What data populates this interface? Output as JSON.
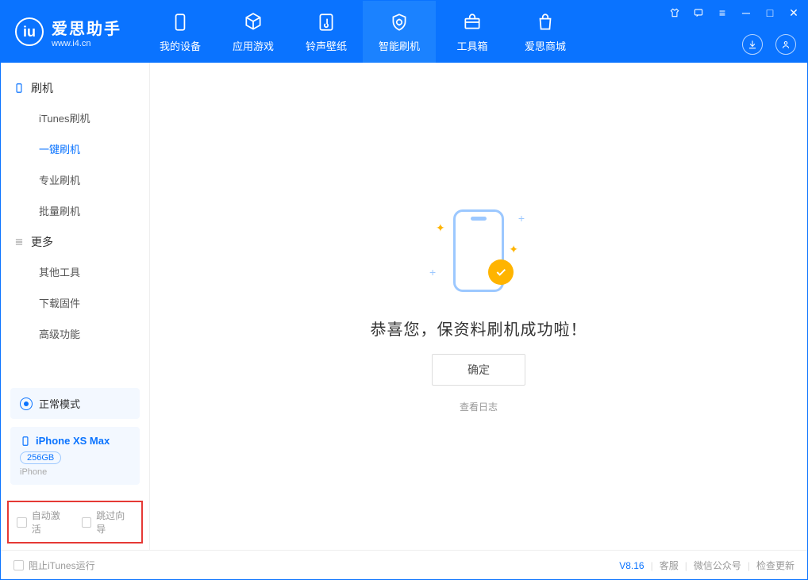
{
  "app": {
    "name": "爱思助手",
    "url": "www.i4.cn"
  },
  "nav": {
    "device": "我的设备",
    "apps": "应用游戏",
    "ringtone": "铃声壁纸",
    "flash": "智能刷机",
    "toolbox": "工具箱",
    "store": "爱思商城"
  },
  "sidebar": {
    "section_flash": "刷机",
    "items_flash": [
      "iTunes刷机",
      "一键刷机",
      "专业刷机",
      "批量刷机"
    ],
    "section_more": "更多",
    "items_more": [
      "其他工具",
      "下载固件",
      "高级功能"
    ]
  },
  "device": {
    "mode": "正常模式",
    "name": "iPhone XS Max",
    "storage": "256GB",
    "type": "iPhone"
  },
  "checkboxes": {
    "auto_activate": "自动激活",
    "skip_guide": "跳过向导"
  },
  "main": {
    "success": "恭喜您，保资料刷机成功啦！",
    "ok": "确定",
    "view_log": "查看日志"
  },
  "footer": {
    "block_itunes": "阻止iTunes运行",
    "version": "V8.16",
    "service": "客服",
    "wechat": "微信公众号",
    "update": "检查更新"
  }
}
